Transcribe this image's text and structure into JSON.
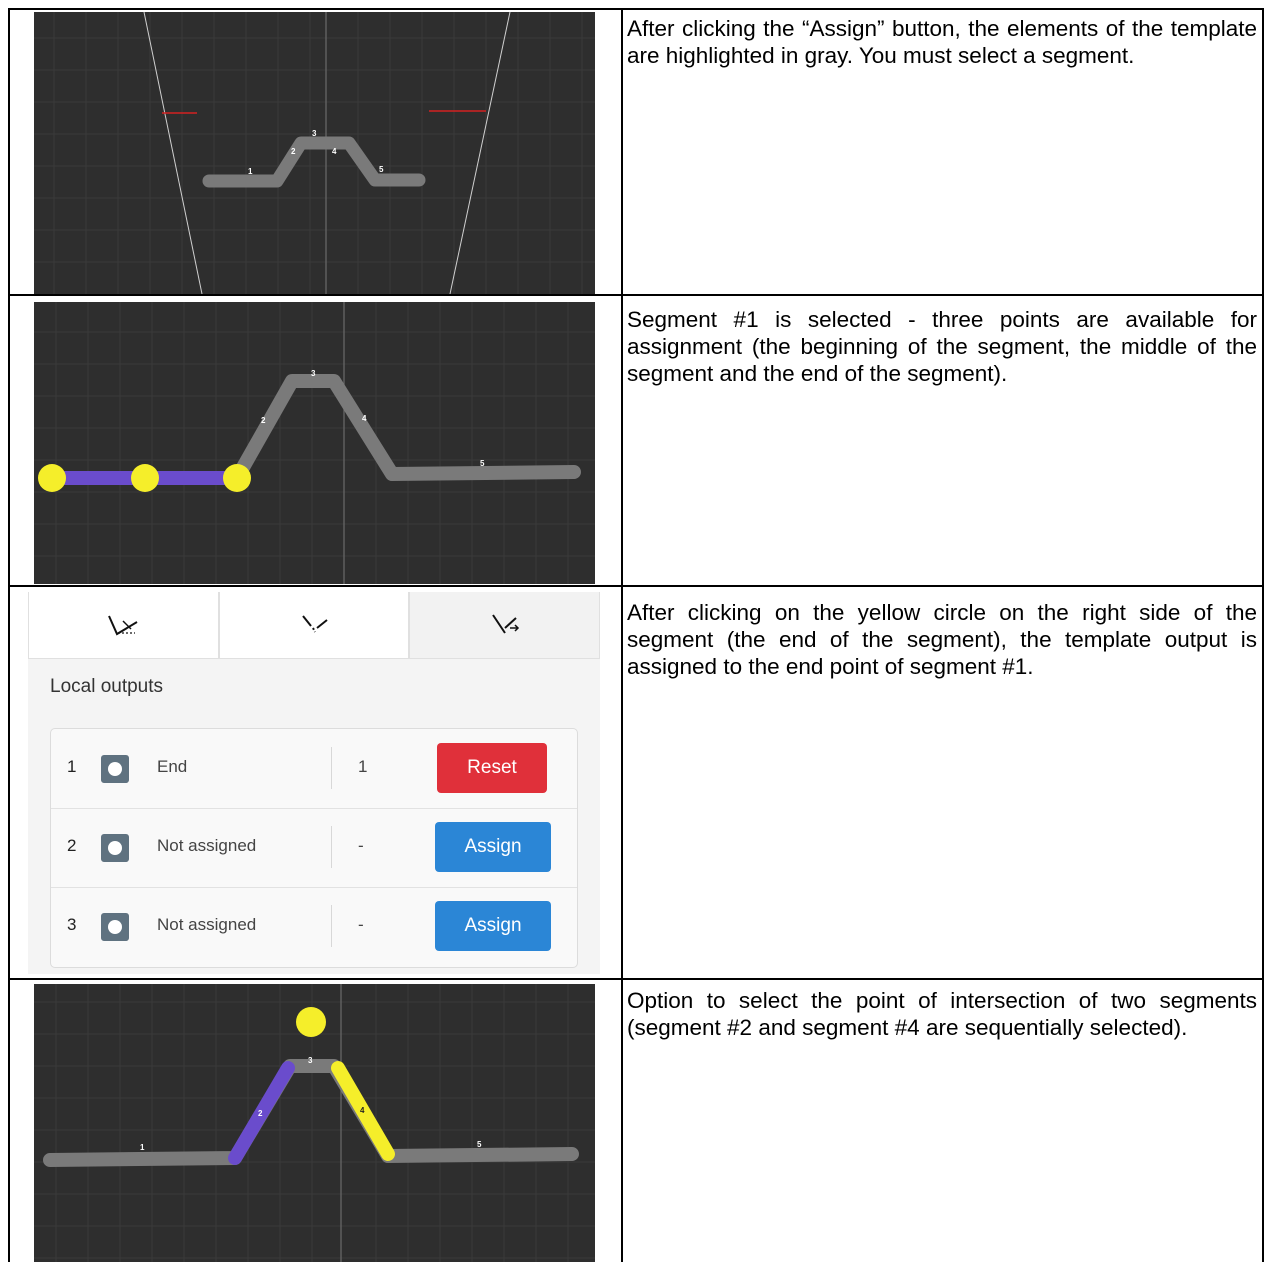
{
  "rows": [
    {
      "description": "After clicking the “Assign” button, the elements of the template are highlighted in gray. You must select a segment."
    },
    {
      "description": "Segment #1 is selected - three points are available for assignment (the beginning of the segment, the middle of the segment and the end of the segment)."
    },
    {
      "description": "After clicking on the yellow circle on the right side of the segment (the end of the segment), the template output is assigned to the end point of segment #1."
    },
    {
      "description": "Option to select the point of intersection of two segments (segment #2 and segment #4 are sequentially selected)."
    }
  ],
  "segment_labels": [
    "1",
    "2",
    "3",
    "4",
    "5"
  ],
  "colors": {
    "canvas_bg": "#2e2e2e",
    "template_gray": "#7a7a7a",
    "selected_purple": "#6a4ccc",
    "point_yellow": "#f5ee2a",
    "reset_red": "#e0303a",
    "assign_blue": "#2b86d6"
  },
  "panel": {
    "tabs": [
      {
        "icon": "angle-measure-icon"
      },
      {
        "icon": "segment-lines-icon"
      },
      {
        "icon": "segment-output-icon"
      }
    ],
    "title": "Local outputs",
    "outputs": [
      {
        "index": "1",
        "point": "End",
        "segment": "1",
        "button": "Reset"
      },
      {
        "index": "2",
        "point": "Not assigned",
        "segment": "-",
        "button": "Assign"
      },
      {
        "index": "3",
        "point": "Not assigned",
        "segment": "-",
        "button": "Assign"
      }
    ]
  }
}
